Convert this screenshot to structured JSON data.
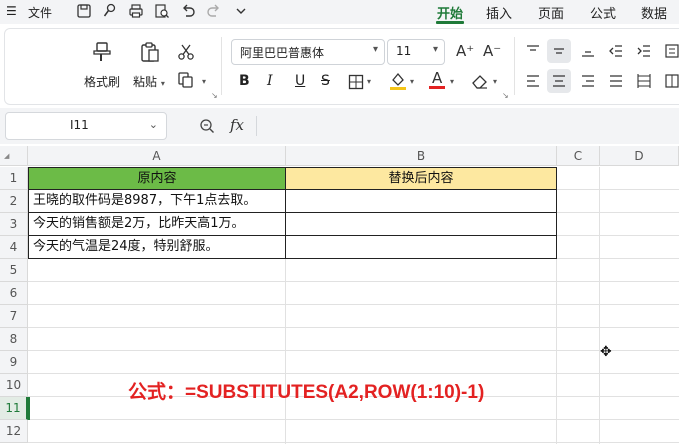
{
  "menubar": {
    "menu_icon": "hamburger-icon",
    "file_label": "文件",
    "tabs": [
      {
        "label": "开始",
        "active": true
      },
      {
        "label": "插入",
        "active": false
      },
      {
        "label": "页面",
        "active": false
      },
      {
        "label": "公式",
        "active": false
      },
      {
        "label": "数据",
        "active": false
      }
    ]
  },
  "ribbon": {
    "format_painter_label": "格式刷",
    "paste_label": "粘贴",
    "font_name": "阿里巴巴普惠体",
    "font_size": "11",
    "bold": "B",
    "italic": "I",
    "underline": "U",
    "strike": "S",
    "font_color": "A",
    "grow_font": "A⁺",
    "shrink_font": "A⁻",
    "accent_color": "#1f7a39",
    "font_color_bar": "#e32222",
    "fill_color_bar": "#f5c518"
  },
  "formula_bar": {
    "name_box": "I11",
    "fx_label": "fx",
    "formula": ""
  },
  "sheet": {
    "columns": [
      "A",
      "B",
      "C",
      "D"
    ],
    "rows": [
      "1",
      "2",
      "3",
      "4",
      "5",
      "6",
      "7",
      "8",
      "9",
      "10",
      "11",
      "12"
    ],
    "selected_row": "11",
    "header": {
      "a": "原内容",
      "b": "替换后内容"
    },
    "data": [
      {
        "a": "王晓的取件码是8987，下午1点去取。",
        "b": ""
      },
      {
        "a": "今天的销售额是2万，比昨天高1万。",
        "b": ""
      },
      {
        "a": "今天的气温是24度，特别舒服。",
        "b": ""
      }
    ],
    "header_colors": {
      "a": "#6cbb47",
      "b": "#fde8a0"
    }
  },
  "annotation": "公式：=SUBSTITUTES(A2,ROW(1:10)-1)"
}
